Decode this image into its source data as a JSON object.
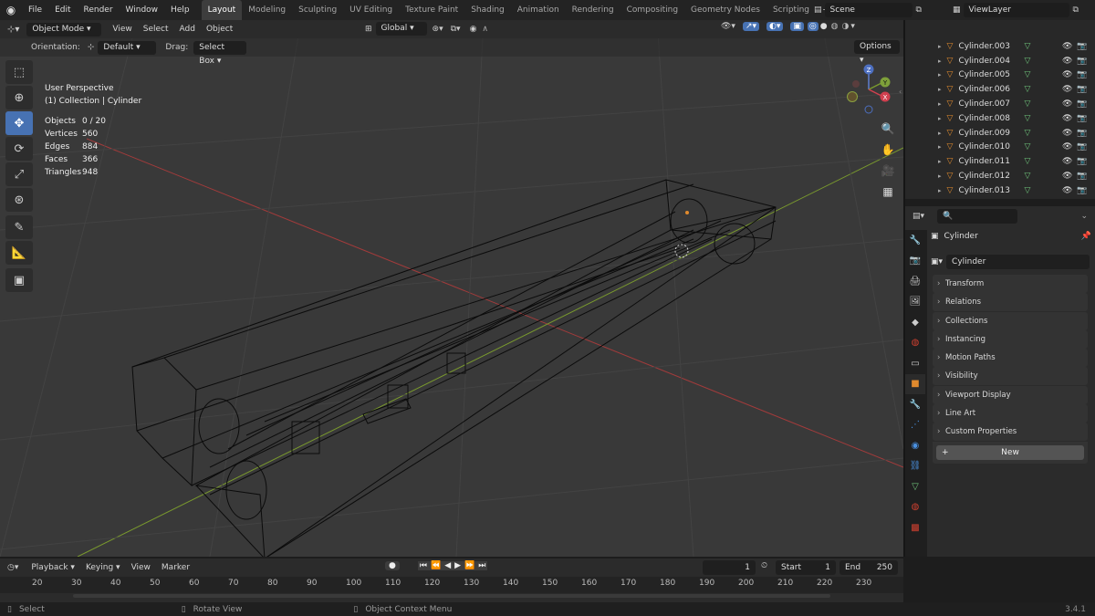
{
  "app": {
    "version": "3.4.1"
  },
  "menu": [
    "File",
    "Edit",
    "Render",
    "Window",
    "Help"
  ],
  "workspaces": [
    {
      "label": "Layout",
      "active": true
    },
    {
      "label": "Modeling"
    },
    {
      "label": "Sculpting"
    },
    {
      "label": "UV Editing"
    },
    {
      "label": "Texture Paint"
    },
    {
      "label": "Shading"
    },
    {
      "label": "Animation"
    },
    {
      "label": "Rendering"
    },
    {
      "label": "Compositing"
    },
    {
      "label": "Geometry Nodes"
    },
    {
      "label": "Scripting"
    }
  ],
  "scene": {
    "name": "Scene",
    "view_layer": "ViewLayer"
  },
  "viewport": {
    "mode": "Object Mode",
    "menus": [
      "View",
      "Select",
      "Add",
      "Object"
    ],
    "transform_orientation": "Global",
    "orientation_label": "Orientation:",
    "orientation_value": "Default",
    "drag_label": "Drag:",
    "drag_value": "Select Box",
    "options_label": "Options",
    "overlay_title": "User Perspective",
    "overlay_subtitle": "(1) Collection | Cylinder",
    "stats": [
      {
        "label": "Objects",
        "value": "0 / 20"
      },
      {
        "label": "Vertices",
        "value": "560"
      },
      {
        "label": "Edges",
        "value": "884"
      },
      {
        "label": "Faces",
        "value": "366"
      },
      {
        "label": "Triangles",
        "value": "948"
      }
    ],
    "gizmo": {
      "x": "X",
      "y": "Y",
      "z": "Z"
    }
  },
  "outliner": {
    "items": [
      {
        "name": "Cylinder.003"
      },
      {
        "name": "Cylinder.004"
      },
      {
        "name": "Cylinder.005"
      },
      {
        "name": "Cylinder.006"
      },
      {
        "name": "Cylinder.007"
      },
      {
        "name": "Cylinder.008"
      },
      {
        "name": "Cylinder.009"
      },
      {
        "name": "Cylinder.010"
      },
      {
        "name": "Cylinder.011"
      },
      {
        "name": "Cylinder.012"
      },
      {
        "name": "Cylinder.013"
      }
    ]
  },
  "properties": {
    "object_name": "Cylinder",
    "data_name": "Cylinder",
    "panels": [
      "Transform",
      "Relations",
      "Collections",
      "Instancing",
      "Motion Paths",
      "Visibility",
      "Viewport Display",
      "Line Art"
    ],
    "custom_properties": "Custom Properties",
    "new_button": "New"
  },
  "timeline": {
    "menus": [
      "Playback",
      "Keying",
      "View",
      "Marker"
    ],
    "current_frame": "1",
    "start_label": "Start",
    "start": "1",
    "end_label": "End",
    "end": "250",
    "ticks": [
      "20",
      "30",
      "40",
      "50",
      "60",
      "70",
      "80",
      "90",
      "100",
      "110",
      "120",
      "130",
      "140",
      "150",
      "160",
      "170",
      "180",
      "190",
      "200",
      "210",
      "220",
      "230"
    ]
  },
  "status": {
    "select": "Select",
    "rotate": "Rotate View",
    "context": "Object Context Menu"
  },
  "colors": {
    "accent": "#4772b3",
    "x_axis": "#a33b3b",
    "y_axis": "#7a9a2e",
    "object_orange": "#e08a2e",
    "mesh_green": "#6ec07a"
  }
}
